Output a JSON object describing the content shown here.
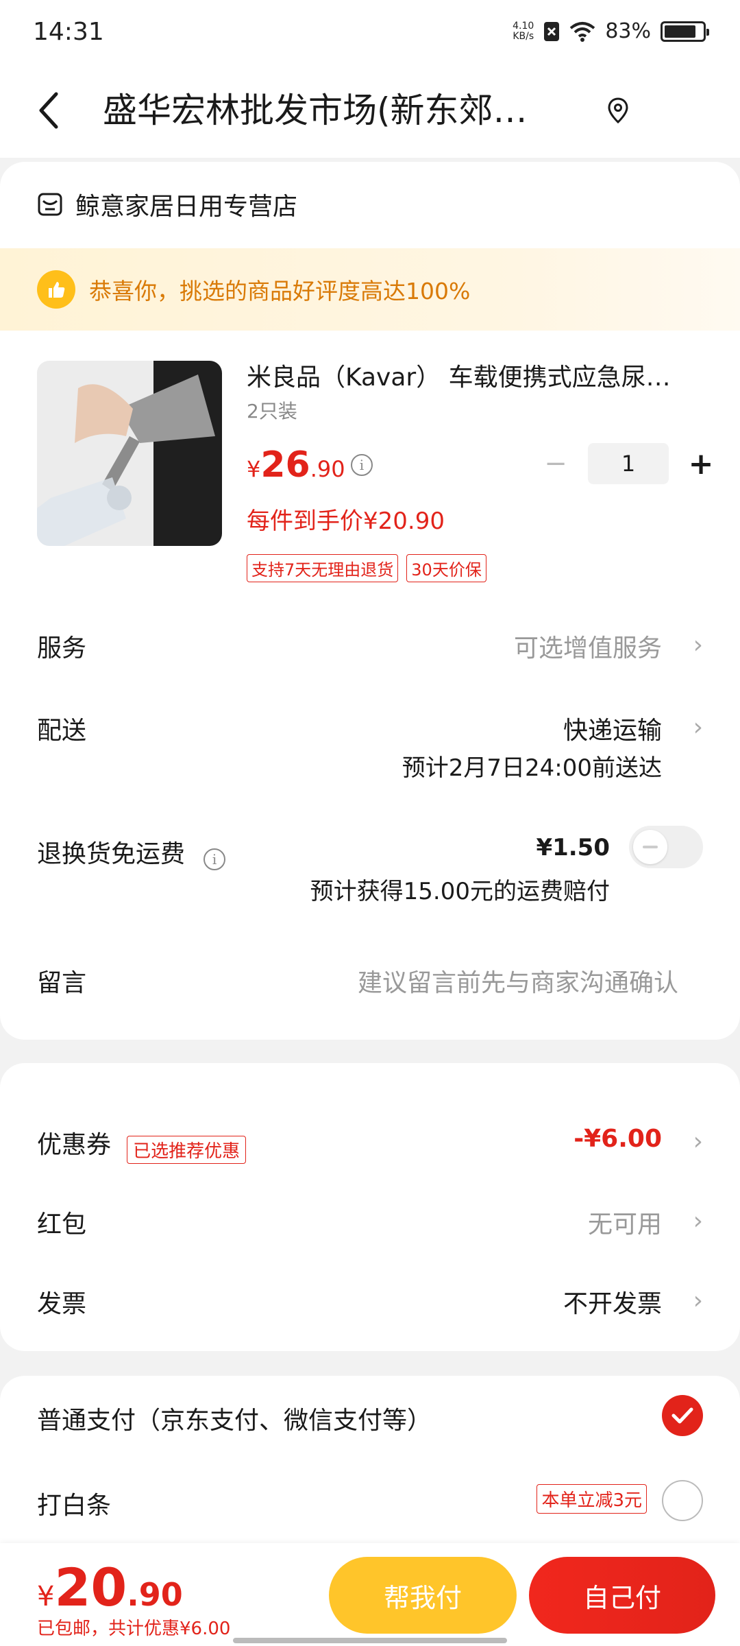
{
  "status_bar": {
    "time": "14:31",
    "net_speed": "4.10",
    "net_unit": "KB/s",
    "battery": "83%",
    "battery_level": 0.83
  },
  "header": {
    "title": "盛华宏林批发市场(新东郊…"
  },
  "store": {
    "name": "鲸意家居日用专营店"
  },
  "banner": {
    "text": "恭喜你，挑选的商品好评度高达100%"
  },
  "product": {
    "title": "米良品（Kavar） 车载便携式应急尿…",
    "spec": "2只装",
    "price_yen": "¥",
    "price_int": "26",
    "price_dec": ".90",
    "quantity": "1",
    "unit_price": "每件到手价¥20.90",
    "tags": [
      "支持7天无理由退货",
      "30天价保"
    ]
  },
  "rows": {
    "service": {
      "label": "服务",
      "value": "可选增值服务"
    },
    "delivery": {
      "label": "配送",
      "value": "快递运输",
      "eta": "预计2月7日24:00前送达"
    },
    "return_fee": {
      "label": "退换货免运费",
      "value": "¥1.50",
      "note": "预计获得15.00元的运费赔付"
    },
    "message": {
      "label": "留言",
      "placeholder": "建议留言前先与商家沟通确认"
    }
  },
  "discounts": {
    "coupon": {
      "label": "优惠券",
      "tag": "已选推荐优惠",
      "value": "-¥6.00"
    },
    "red_packet": {
      "label": "红包",
      "value": "无可用"
    },
    "invoice": {
      "label": "发票",
      "value": "不开发票"
    }
  },
  "payment": {
    "normal": {
      "label": "普通支付（京东支付、微信支付等）",
      "selected": true
    },
    "baitiao": {
      "label": "打白条",
      "promo": "本单立减3元",
      "selected": false
    }
  },
  "bottom": {
    "total_yen": "¥",
    "total_int": "20",
    "total_dec": ".90",
    "summary": "已包邮，共计优惠¥6.00",
    "help_pay": "帮我付",
    "self_pay": "自己付"
  },
  "colors": {
    "accent": "#e2231a",
    "help_button": "#ffc52a",
    "banner_text": "#d97a07"
  },
  "icons": [
    "back-icon",
    "location-icon",
    "store-icon",
    "thumbs-up-icon",
    "info-icon",
    "chevron-right-icon",
    "check-icon"
  ]
}
